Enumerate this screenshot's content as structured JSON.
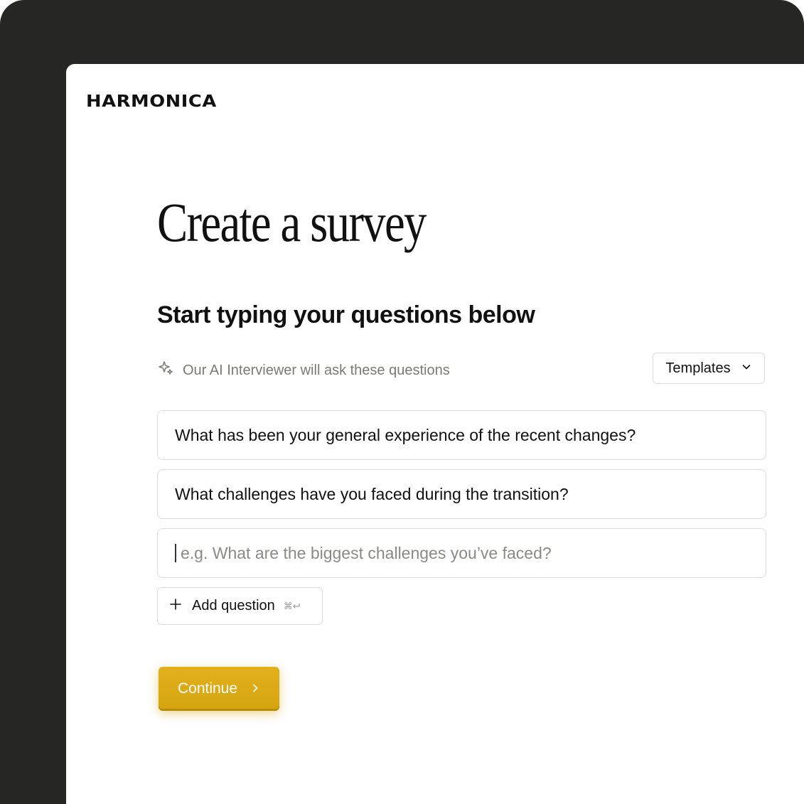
{
  "app": {
    "logo": "HARMONICA"
  },
  "page": {
    "title": "Create a survey",
    "subtitle": "Start typing your questions below",
    "hint": "Our AI Interviewer will ask these questions",
    "hint_icon": "sparkle-icon"
  },
  "templates": {
    "label": "Templates",
    "icon": "chevron-down-icon"
  },
  "questions": [
    {
      "value": "What has been your general experience of the recent changes?"
    },
    {
      "value": "What challenges have you faced during the transition?"
    }
  ],
  "new_question": {
    "value": "",
    "placeholder": "e.g. What are the biggest challenges you’ve faced?"
  },
  "add_question": {
    "label": "Add question",
    "shortcut": "⌘↩",
    "icon": "plus-icon"
  },
  "continue": {
    "label": "Continue",
    "icon": "chevron-right-icon",
    "color": "#D9A812"
  },
  "colors": {
    "frame": "#262624",
    "accent": "#D9A812",
    "text": "#111111",
    "muted": "#7A7A75",
    "border": "#DCDCD8"
  }
}
